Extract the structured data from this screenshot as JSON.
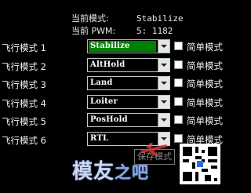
{
  "status": {
    "current_mode_label": "当前模式:",
    "current_mode_value": "Stabilize",
    "current_pwm_label": "当前 PWM:",
    "current_pwm_value": "5: 1182"
  },
  "modes": [
    {
      "label": "飞行模式 1",
      "value": "Stabilize",
      "selected": true,
      "simple_label": "简单模式"
    },
    {
      "label": "飞行模式 2",
      "value": "AltHold",
      "selected": false,
      "simple_label": "简单模式"
    },
    {
      "label": "飞行模式 3",
      "value": "Land",
      "selected": false,
      "simple_label": "简单模式"
    },
    {
      "label": "飞行模式 4",
      "value": "Loiter",
      "selected": false,
      "simple_label": "简单模式"
    },
    {
      "label": "飞行模式 5",
      "value": "PosHold",
      "selected": false,
      "simple_label": "简单模式"
    },
    {
      "label": "飞行模式 6",
      "value": "RTL",
      "selected": false,
      "simple_label": "简单模式"
    }
  ],
  "save_button": "保存模式",
  "watermark": {
    "main": "模友",
    "sub": "之吧"
  },
  "colors": {
    "selected_bg": "#008000",
    "background": "#000000"
  }
}
